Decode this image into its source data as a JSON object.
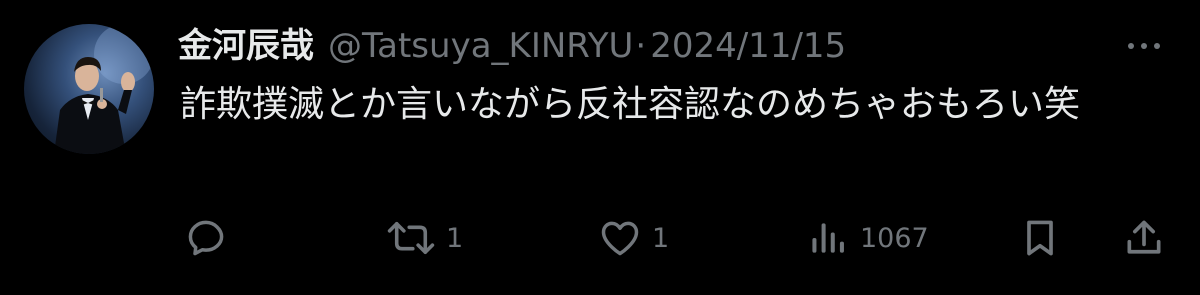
{
  "tweet": {
    "display_name": "金河辰哉",
    "handle": "@Tatsuya_KINRYU",
    "separator": "·",
    "date": "2024/11/15",
    "text": "詐欺撲滅とか言いながら反社容認なのめちゃおもろい笑"
  },
  "actions": {
    "reply": {
      "icon": "reply-icon"
    },
    "retweet": {
      "icon": "retweet-icon",
      "count": "1"
    },
    "like": {
      "icon": "heart-icon",
      "count": "1"
    },
    "views": {
      "icon": "views-icon",
      "count": "1067"
    },
    "bookmark": {
      "icon": "bookmark-icon"
    },
    "share": {
      "icon": "share-icon"
    }
  },
  "colors": {
    "background": "#000000",
    "primary_text": "#e7e9ea",
    "secondary_text": "#71767b"
  }
}
